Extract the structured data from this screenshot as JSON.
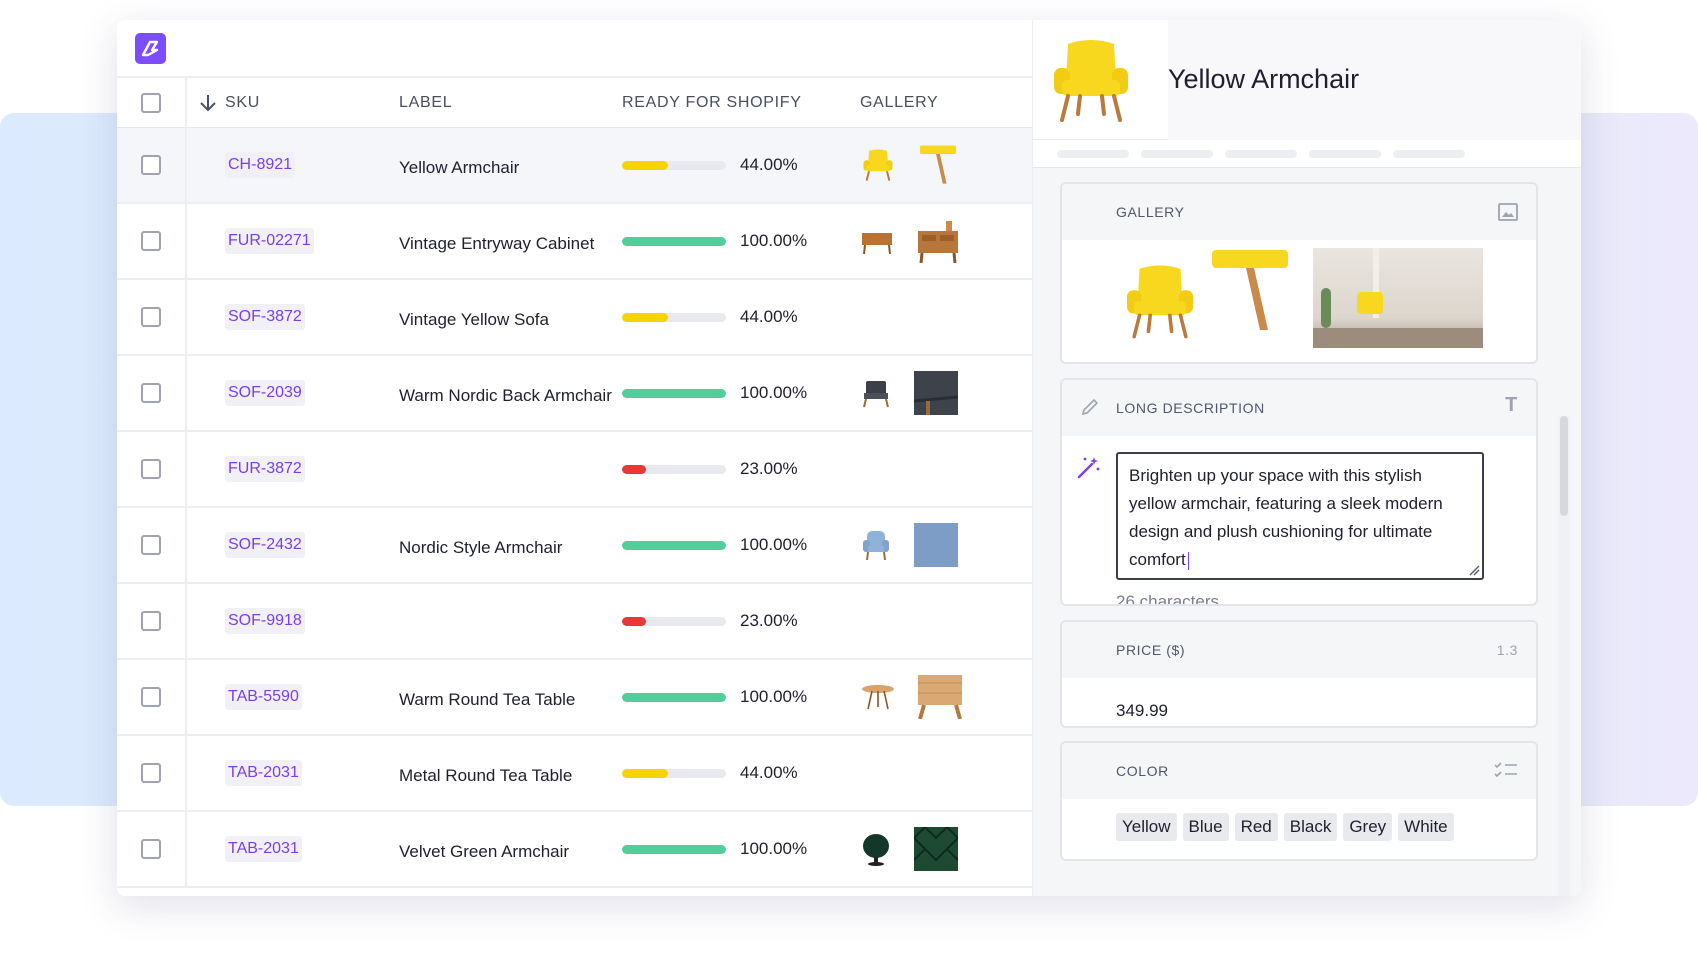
{
  "columns": {
    "sku": "SKU",
    "label": "LABEL",
    "ready": "READY FOR SHOPIFY",
    "gallery": "GALLERY"
  },
  "rows": [
    {
      "sku": "CH-8921",
      "label": "Yellow Armchair",
      "pct": "44.00%",
      "fill": 0.44,
      "color": "#f5d400",
      "gallery": [
        "yellow-armchair",
        "chair-leg"
      ]
    },
    {
      "sku": "FUR-02271",
      "label": "Vintage Entryway Cabinet",
      "pct": "100.00%",
      "fill": 1.0,
      "color": "#4fcf9a",
      "gallery": [
        "wood-cabinet",
        "wood-cabinet-detail"
      ]
    },
    {
      "sku": "SOF-3872",
      "label": "Vintage Yellow Sofa",
      "pct": "44.00%",
      "fill": 0.44,
      "color": "#f5d400",
      "gallery": []
    },
    {
      "sku": "SOF-2039",
      "label": "Warm Nordic Back Armchair",
      "pct": "100.00%",
      "fill": 1.0,
      "color": "#4fcf9a",
      "gallery": [
        "dark-armchair",
        "dark-fabric"
      ]
    },
    {
      "sku": "FUR-3872",
      "label": "",
      "pct": "23.00%",
      "fill": 0.23,
      "color": "#e53935",
      "gallery": []
    },
    {
      "sku": "SOF-2432",
      "label": "Nordic Style Armchair",
      "pct": "100.00%",
      "fill": 1.0,
      "color": "#4fcf9a",
      "gallery": [
        "blue-armchair",
        "blue-fabric"
      ]
    },
    {
      "sku": "SOF-9918",
      "label": "",
      "pct": "23.00%",
      "fill": 0.23,
      "color": "#e53935",
      "gallery": []
    },
    {
      "sku": "TAB-5590",
      "label": "Warm Round Tea Table",
      "pct": "100.00%",
      "fill": 1.0,
      "color": "#4fcf9a",
      "gallery": [
        "round-table",
        "wood-table-detail"
      ]
    },
    {
      "sku": "TAB-2031",
      "label": "Metal Round Tea Table",
      "pct": "44.00%",
      "fill": 0.44,
      "color": "#f5d400",
      "gallery": []
    },
    {
      "sku": "TAB-2031",
      "label": "Velvet Green Armchair",
      "pct": "100.00%",
      "fill": 1.0,
      "color": "#4fcf9a",
      "gallery": [
        "green-chair",
        "green-velvet"
      ]
    }
  ],
  "panel": {
    "title": "Yellow Armchair",
    "gallery_label": "GALLERY",
    "long_desc_label": "LONG DESCRIPTION",
    "long_desc_value": "Brighten up your space with this stylish yellow armchair, featuring a sleek modern design and plush cushioning for ultimate comfort",
    "char_count": "26 characters",
    "price_label": "PRICE ($)",
    "price_icon_text": "1.3",
    "price_value": "349.99",
    "color_label": "COLOR",
    "colors": [
      "Yellow",
      "Blue",
      "Red",
      "Black",
      "Grey",
      "White"
    ]
  },
  "accent": "#7b3fe4"
}
